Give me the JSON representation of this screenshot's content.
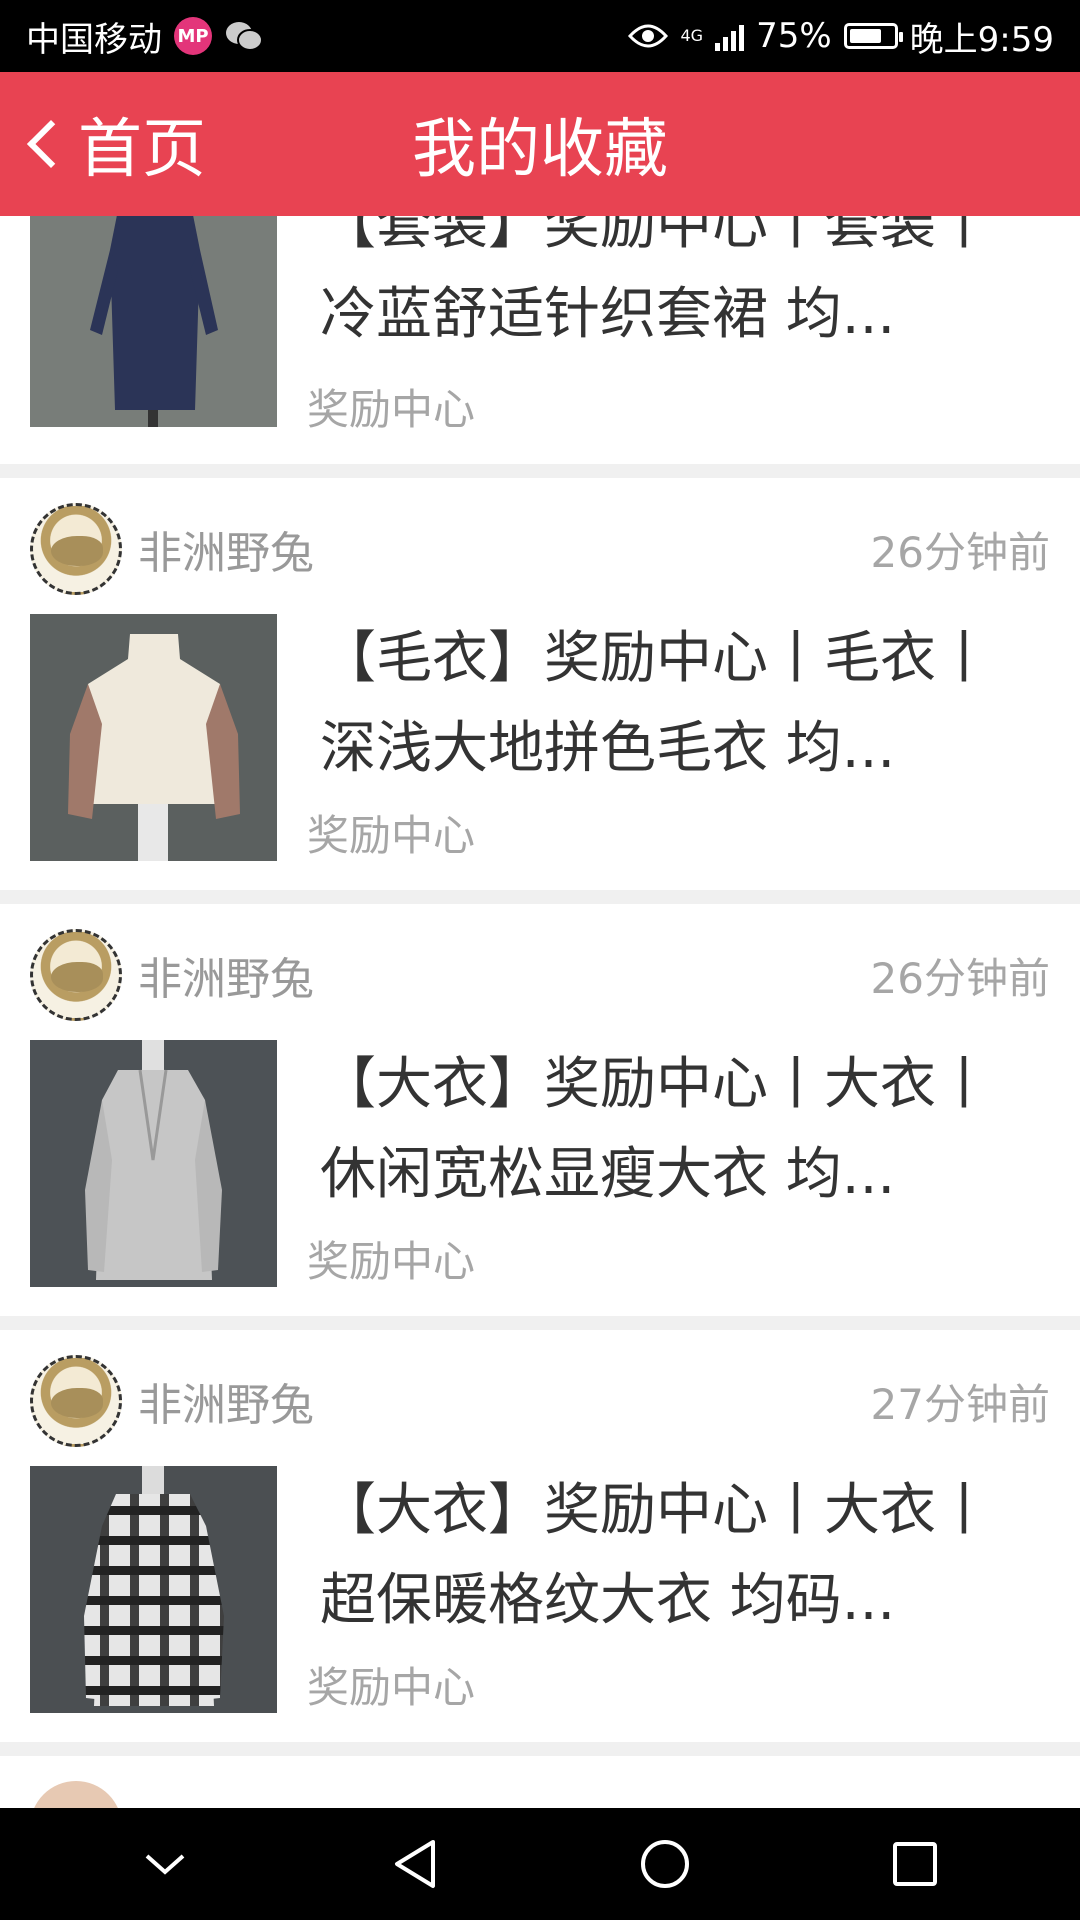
{
  "status_bar": {
    "carrier": "中国移动",
    "mp_badge": "MP",
    "network": "4G",
    "battery": "75%",
    "battery_level": 0.75,
    "time": "晚上9:59"
  },
  "header": {
    "back_label": "首页",
    "title": "我的收藏"
  },
  "items": [
    {
      "author": "",
      "time": "",
      "title": "【套装】奖励中心丨套装丨冷蓝舒适针织套裙 均...",
      "source": "奖励中心"
    },
    {
      "author": "非洲野兔",
      "time": "26分钟前",
      "title": "【毛衣】奖励中心丨毛衣丨深浅大地拼色毛衣 均...",
      "source": "奖励中心"
    },
    {
      "author": "非洲野兔",
      "time": "26分钟前",
      "title": "【大衣】奖励中心丨大衣丨休闲宽松显瘦大衣 均...",
      "source": "奖励中心"
    },
    {
      "author": "非洲野兔",
      "time": "27分钟前",
      "title": "【大衣】奖励中心丨大衣丨超保暖格纹大衣 均码...",
      "source": "奖励中心"
    }
  ],
  "colors": {
    "accent": "#e84352",
    "muted_text": "#a6a6a6",
    "title_text": "#333333"
  },
  "icons": {
    "back": "chevron-left-icon",
    "nav_down": "chevron-down-icon",
    "nav_back": "triangle-back-icon",
    "nav_home": "circle-home-icon",
    "nav_recents": "square-recents-icon"
  }
}
